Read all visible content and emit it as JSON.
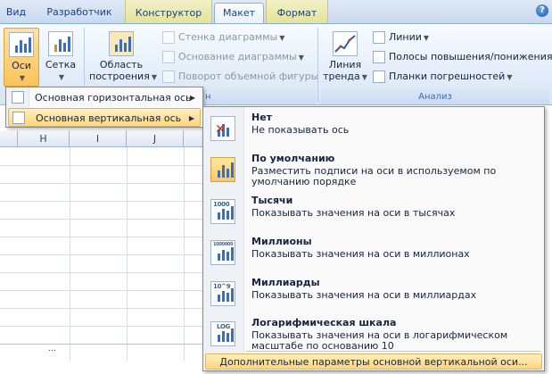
{
  "tabs": [
    {
      "label": "Вид"
    },
    {
      "label": "Разработчик"
    },
    {
      "label": "Конструктор"
    },
    {
      "label": "Макет"
    },
    {
      "label": "Формат"
    }
  ],
  "help_label": "?",
  "ribbon": {
    "axes_label": "Оси",
    "gridlines_label": "Сетка",
    "plot_area_label_1": "Область",
    "plot_area_label_2": "построения",
    "chart_wall_label": "Стенка диаграммы",
    "chart_floor_label": "Основание диаграммы",
    "rotation_label": "Поворот объемной фигуры",
    "trendline_label_1": "Линия",
    "trendline_label_2": "тренда",
    "lines_label": "Линии",
    "updown_bars_label": "Полосы повышения/понижения",
    "error_bars_label": "Планки погрешностей",
    "analysis_group_label": "Анализ",
    "background_group_label_fragment": "н"
  },
  "columns": [
    "H",
    "I",
    "J"
  ],
  "axes_menu": [
    {
      "label": "Основная горизонтальная ось"
    },
    {
      "label": "Основная вертикальная ось"
    }
  ],
  "vertical_axis_submenu": {
    "options": [
      {
        "title": "Нет",
        "desc": "Не показывать ось",
        "icon": "no-axis-icon"
      },
      {
        "title": "По умолчанию",
        "desc": "Разместить подписи на оси в используемом по умолчанию порядке",
        "icon": "default-axis-icon"
      },
      {
        "title": "Тысячи",
        "desc": "Показывать значения на оси в тысячах",
        "icon": "thousands-axis-icon",
        "icon_text": "1000"
      },
      {
        "title": "Миллионы",
        "desc": "Показывать значения на оси в миллионах",
        "icon": "millions-axis-icon",
        "icon_text": "1000000"
      },
      {
        "title": "Миллиарды",
        "desc": "Показывать значения на оси в миллиардах",
        "icon": "billions-axis-icon",
        "icon_text": "10^9"
      },
      {
        "title": "Логарифмическая шкала",
        "desc": "Показывать значения на оси в логарифмическом масштабе по основанию 10",
        "icon": "log-axis-icon",
        "icon_text": "LOG"
      }
    ],
    "footer": "Дополнительные параметры основной вертикальной оси..."
  },
  "colors": {
    "ribbon_bg": "#e4eefa",
    "active_tab_border": "#8daed9",
    "highlight": "#fed67e",
    "bar_blue": "#3c6fb8"
  }
}
